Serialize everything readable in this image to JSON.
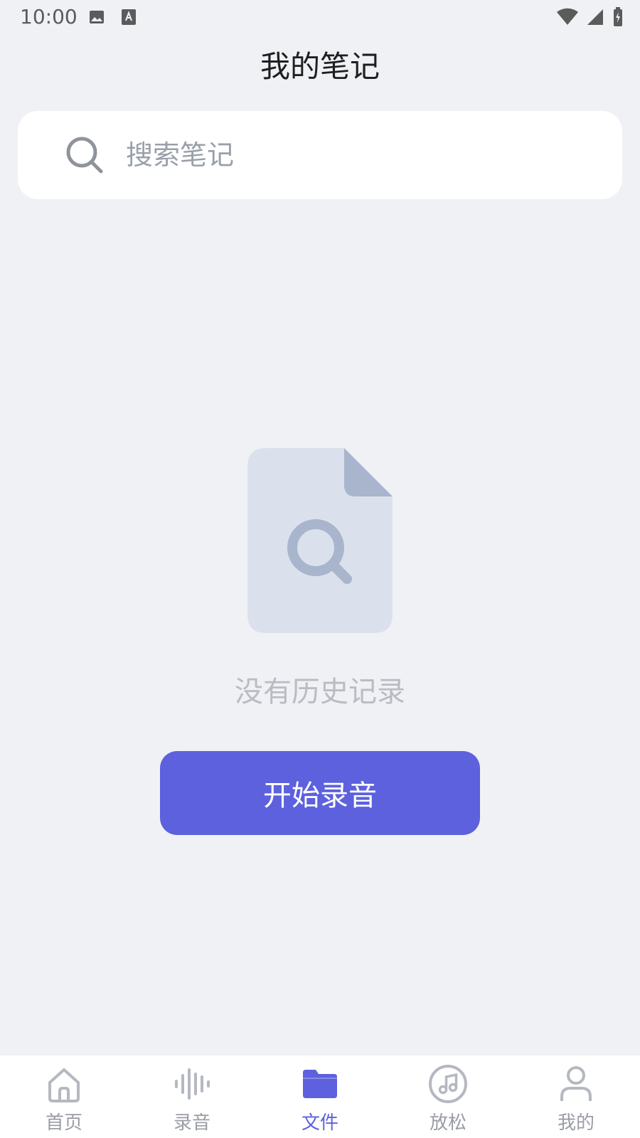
{
  "status_bar": {
    "time": "10:00",
    "icons": [
      "image-icon",
      "text-format-icon",
      "wifi-icon",
      "signal-icon",
      "battery-icon"
    ]
  },
  "header": {
    "title": "我的笔记"
  },
  "search": {
    "placeholder": "搜索笔记"
  },
  "empty_state": {
    "message": "没有历史记录",
    "button_label": "开始录音",
    "illustration_icon": "document-search-icon"
  },
  "bottom_nav": {
    "items": [
      {
        "label": "首页",
        "icon": "home-icon",
        "active": false
      },
      {
        "label": "录音",
        "icon": "waveform-icon",
        "active": false
      },
      {
        "label": "文件",
        "icon": "folder-icon",
        "active": true
      },
      {
        "label": "放松",
        "icon": "music-note-icon",
        "active": false
      },
      {
        "label": "我的",
        "icon": "user-icon",
        "active": false
      }
    ]
  },
  "colors": {
    "accent": "#5d61dd",
    "background": "#f0f1f5",
    "muted_text": "#9a9da5",
    "illustration_fill": "#dbe1ec",
    "illustration_dark": "#a8b5cc"
  }
}
